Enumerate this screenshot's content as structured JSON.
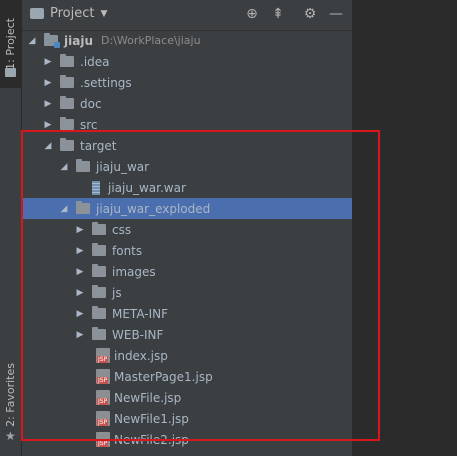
{
  "stripe": {
    "project_tab": "1: Project",
    "favorites_tab": "2: Favorites"
  },
  "panel": {
    "title": "Project"
  },
  "tree": {
    "root": {
      "name": "jiaju",
      "path": "D:\\WorkPlace\\jiaju"
    },
    "items": [
      {
        "label": ".idea"
      },
      {
        "label": ".settings"
      },
      {
        "label": "doc"
      },
      {
        "label": "src"
      },
      {
        "label": "target"
      },
      {
        "label": "jiaju_war"
      },
      {
        "label": "jiaju_war.war"
      },
      {
        "label": "jiaju_war_exploded"
      },
      {
        "label": "css"
      },
      {
        "label": "fonts"
      },
      {
        "label": "images"
      },
      {
        "label": "js"
      },
      {
        "label": "META-INF"
      },
      {
        "label": "WEB-INF"
      },
      {
        "label": "index.jsp"
      },
      {
        "label": "MasterPage1.jsp"
      },
      {
        "label": "NewFile.jsp"
      },
      {
        "label": "NewFile1.jsp"
      },
      {
        "label": "NewFile2.jsp"
      }
    ],
    "selected": "jiaju_war_exploded"
  },
  "colors": {
    "selection": "#4b6eaf",
    "highlight_box": "#d9161c",
    "panel_bg": "#3c3f41"
  }
}
